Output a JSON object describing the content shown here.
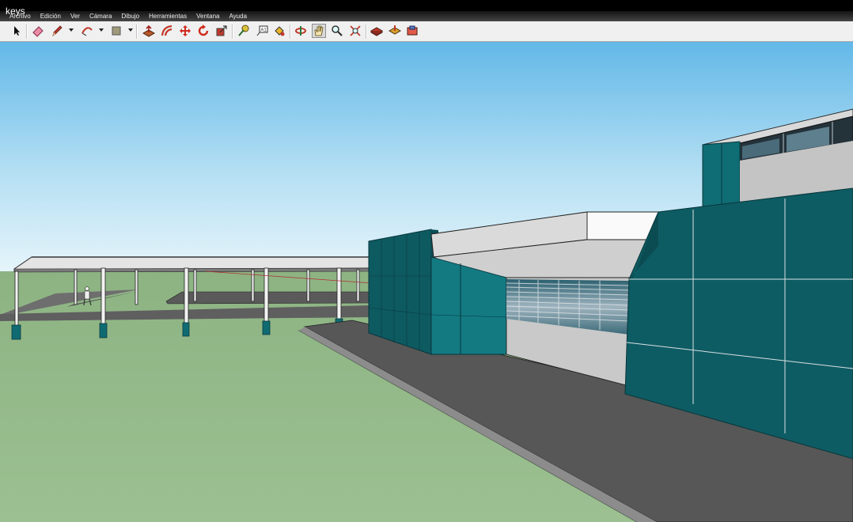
{
  "window": {
    "title": "keys"
  },
  "menu": {
    "items": [
      "Archivo",
      "Edición",
      "Ver",
      "Cámara",
      "Dibujo",
      "Herramientas",
      "Ventana",
      "Ayuda"
    ]
  },
  "toolbar": {
    "tools": [
      {
        "name": "select",
        "icon": "arrow-cursor-icon"
      },
      {
        "name": "eraser",
        "icon": "eraser-icon"
      },
      {
        "name": "line",
        "icon": "pencil-icon",
        "has_dropdown": true
      },
      {
        "name": "arc",
        "icon": "arc-icon",
        "has_dropdown": true
      },
      {
        "name": "rectangle",
        "icon": "rectangle-icon",
        "has_dropdown": true
      },
      {
        "name": "push-pull",
        "icon": "push-pull-icon"
      },
      {
        "name": "offset",
        "icon": "offset-icon"
      },
      {
        "name": "move",
        "icon": "move-icon"
      },
      {
        "name": "rotate",
        "icon": "rotate-icon"
      },
      {
        "name": "scale",
        "icon": "scale-icon"
      },
      {
        "name": "tape-measure",
        "icon": "tape-measure-icon"
      },
      {
        "name": "text",
        "icon": "text-icon"
      },
      {
        "name": "paint-bucket",
        "icon": "paint-bucket-icon"
      },
      {
        "name": "orbit",
        "icon": "orbit-icon"
      },
      {
        "name": "pan",
        "icon": "hand-icon",
        "active": true
      },
      {
        "name": "zoom",
        "icon": "magnifier-icon"
      },
      {
        "name": "zoom-extents",
        "icon": "zoom-extents-icon"
      },
      {
        "name": "warehouse",
        "icon": "warehouse-icon"
      },
      {
        "name": "share-model",
        "icon": "share-model-icon"
      },
      {
        "name": "extension-warehouse",
        "icon": "extension-warehouse-icon"
      }
    ]
  },
  "colors": {
    "sky_top": "#62b8e8",
    "sky_bottom": "#e6f4fb",
    "ground": "#97b98c",
    "panel_teal": "#0f5b62",
    "panel_teal_light": "#157a82",
    "pavement": "#545454",
    "curb": "#a9a9a9",
    "wall_light": "#c9c9c9"
  }
}
